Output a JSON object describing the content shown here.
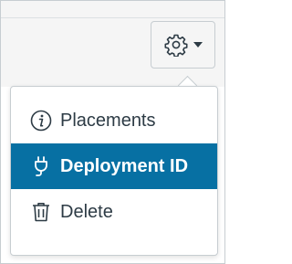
{
  "settings_menu_button": {
    "icon": "gear-icon",
    "caret": "caret-down-icon"
  },
  "menu": {
    "items": [
      {
        "label": "Placements",
        "icon": "info-icon"
      },
      {
        "label": "Deployment ID",
        "icon": "plug-icon",
        "selected": true
      },
      {
        "label": "Delete",
        "icon": "trash-icon"
      }
    ]
  },
  "colors": {
    "accent": "#0770a3",
    "text": "#2d3b45",
    "border": "#c7cdd1",
    "header_bg": "#f5f5f5"
  }
}
